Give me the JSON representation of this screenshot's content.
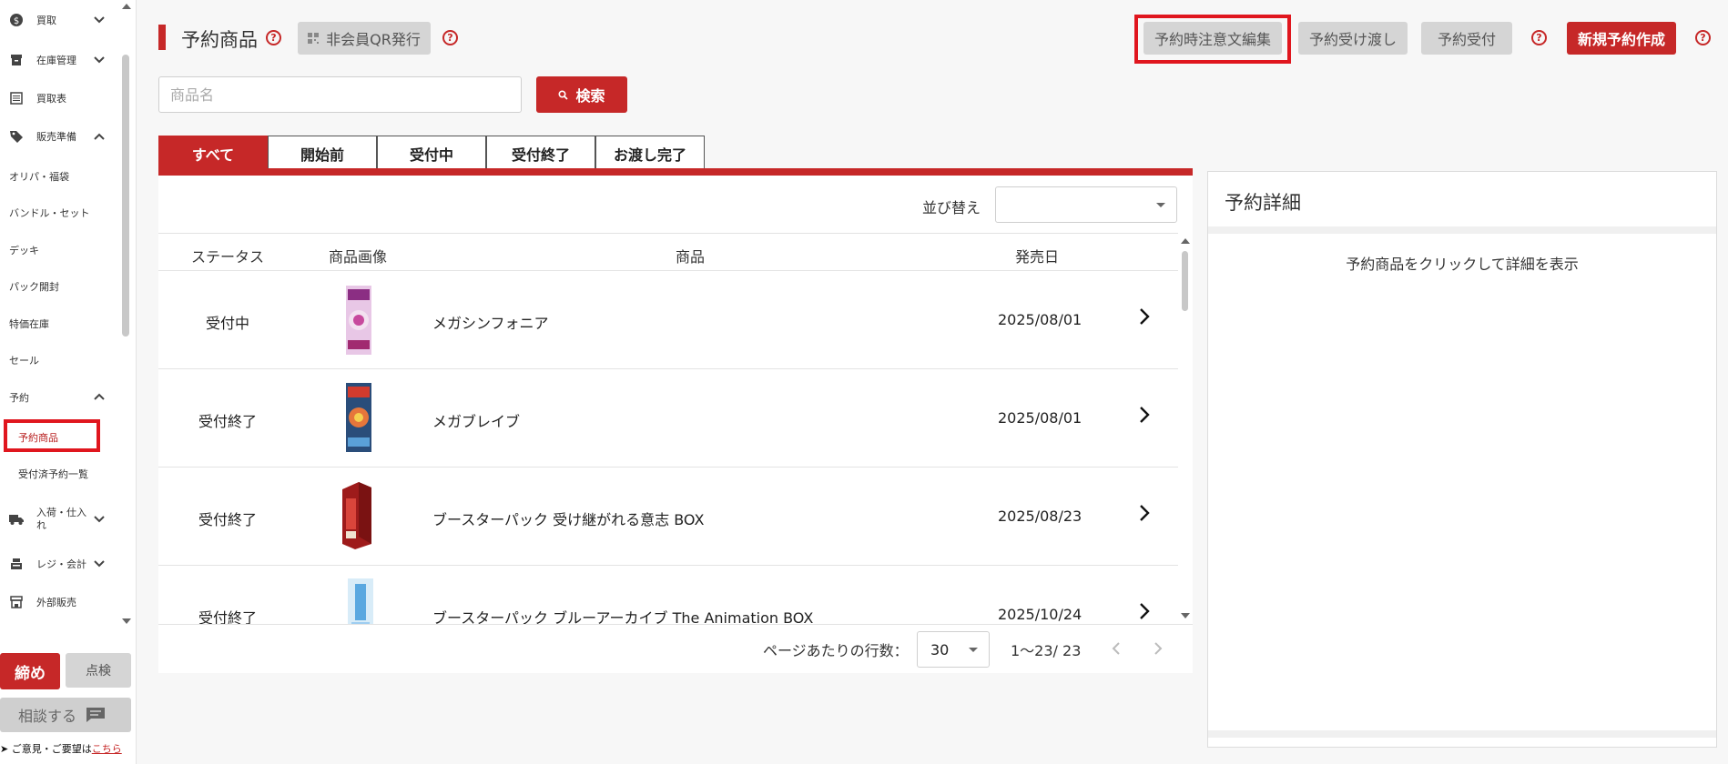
{
  "sidebar": {
    "items": [
      {
        "label": "買取",
        "icon": "dollar-icon"
      },
      {
        "label": "在庫管理",
        "icon": "archive-icon"
      },
      {
        "label": "買取表",
        "icon": "list-icon"
      },
      {
        "label": "販売準備",
        "icon": "tag-icon"
      },
      {
        "label": "入荷・仕入れ",
        "icon": "truck-icon"
      },
      {
        "label": "レジ・会計",
        "icon": "register-icon"
      },
      {
        "label": "外部販売",
        "icon": "store-icon"
      }
    ],
    "subitems": {
      "oripa": "オリパ・福袋",
      "bundle": "バンドル・セット",
      "deck": "デッキ",
      "pack": "パック開封",
      "tokka": "特価在庫",
      "sale": "セール",
      "yoyaku": "予約",
      "yoyaku_shohin": "予約商品",
      "uketsuke_ichiran": "受付済予約一覧"
    },
    "shime_label": "締め",
    "tenken_label": "点検",
    "soudan_label": "相談する",
    "feedback_prefix": "ご意見・ご要望は",
    "feedback_link": "こちら"
  },
  "header": {
    "title": "予約商品",
    "qr_button": "非会員QR発行",
    "notice_edit_button": "予約時注意文編集",
    "handover_button": "予約受け渡し",
    "reception_button": "予約受付",
    "new_button": "新規予約作成"
  },
  "search": {
    "placeholder": "商品名",
    "button_label": "検索"
  },
  "tabs": [
    {
      "label": "すべて",
      "active": true
    },
    {
      "label": "開始前",
      "active": false
    },
    {
      "label": "受付中",
      "active": false
    },
    {
      "label": "受付終了",
      "active": false
    },
    {
      "label": "お渡し完了",
      "active": false
    }
  ],
  "table": {
    "sort_label": "並び替え",
    "headers": {
      "status": "ステータス",
      "image": "商品画像",
      "product": "商品",
      "release": "発売日"
    },
    "rows": [
      {
        "status": "受付中",
        "product": "メガシンフォニア",
        "release": "2025/08/01"
      },
      {
        "status": "受付終了",
        "product": "メガブレイブ",
        "release": "2025/08/01"
      },
      {
        "status": "受付終了",
        "product": "ブースターパック 受け継がれる意志 BOX",
        "release": "2025/08/23"
      },
      {
        "status": "受付終了",
        "product": "ブースターパック ブルーアーカイブ The Animation BOX",
        "release": "2025/10/24"
      }
    ]
  },
  "pagination": {
    "rows_per_page_label": "ページあたりの行数：",
    "rows_per_page": "30",
    "range": "1〜23/ 23"
  },
  "detail": {
    "title": "予約詳細",
    "message": "予約商品をクリックして詳細を表示"
  },
  "colors": {
    "accent": "#c62828",
    "highlight": "#e0161e",
    "gray_button": "#d5d5d5"
  }
}
